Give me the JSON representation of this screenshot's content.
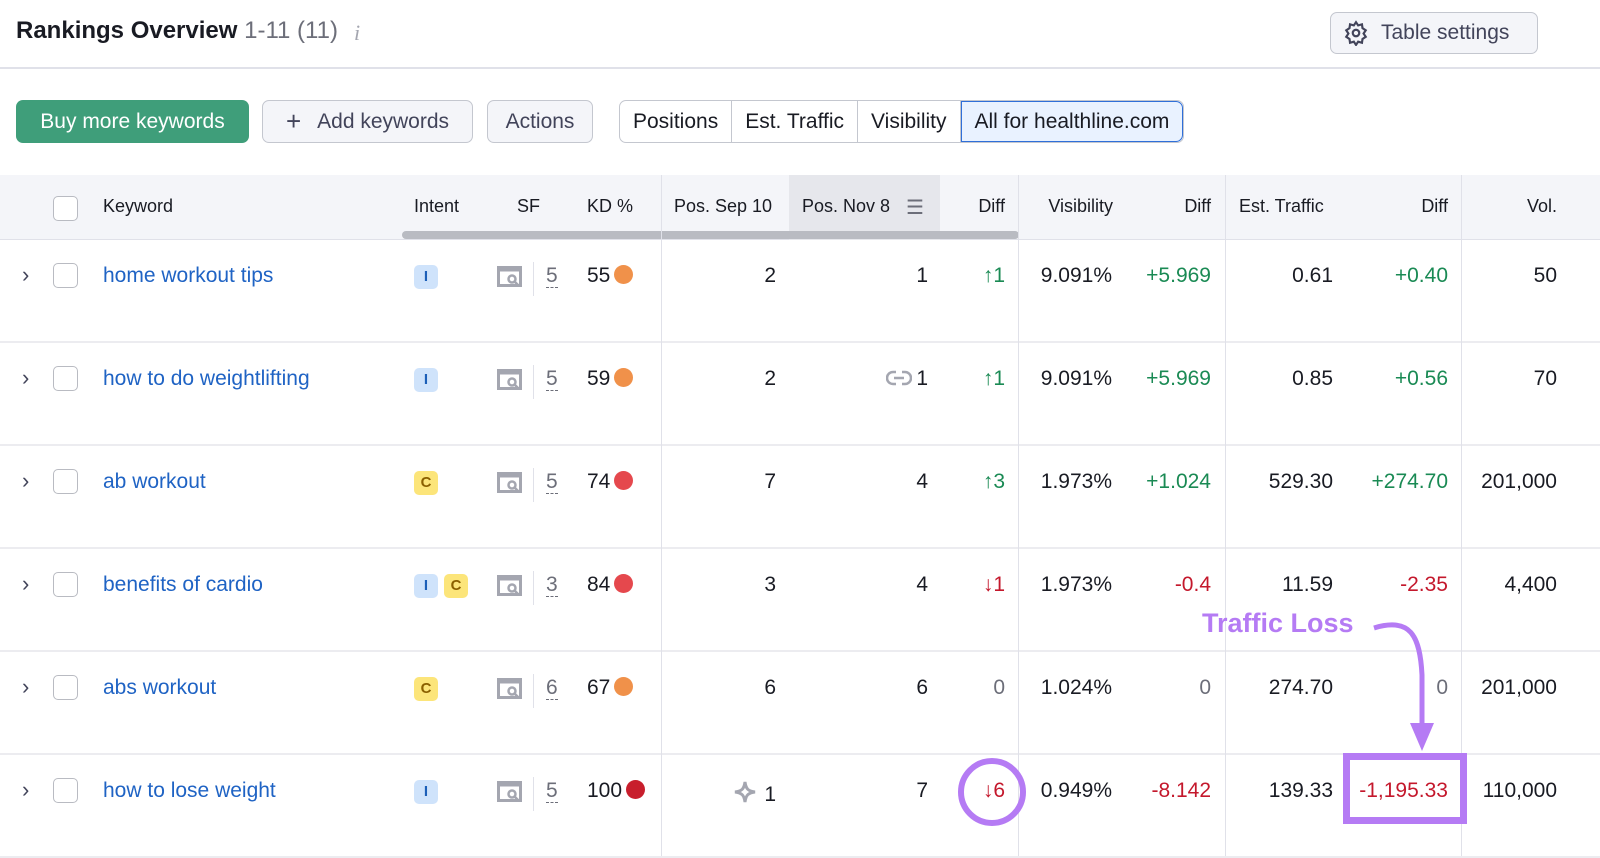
{
  "header": {
    "title": "Rankings Overview",
    "count": "1-11 (11)",
    "info_icon": "i",
    "table_settings": "Table settings"
  },
  "toolbar": {
    "buy": "Buy more keywords",
    "add": "Add keywords",
    "actions": "Actions",
    "segments": [
      "Positions",
      "Est. Traffic",
      "Visibility",
      "All for healthline.com"
    ],
    "selected_segment": "All for healthline.com"
  },
  "columns": {
    "keyword": "Keyword",
    "intent": "Intent",
    "sf": "SF",
    "kd": "KD %",
    "pos1": "Pos. Sep 10",
    "pos2": "Pos. Nov 8",
    "diff": "Diff",
    "vis": "Visibility",
    "vdiff": "Diff",
    "traffic": "Est. Traffic",
    "tdiff": "Diff",
    "vol": "Vol."
  },
  "colors": {
    "positive": "#1a8a54",
    "negative": "#c4182c",
    "kd_orange": "#f0914a",
    "kd_red": "#e5484d",
    "kd_darkred": "#c81e2c",
    "annotation": "#b57bf4"
  },
  "rows": [
    {
      "keyword": "home workout tips",
      "intent": [
        "I"
      ],
      "sf": "5",
      "kd": "55",
      "kd_color": "orange",
      "pos1": "2",
      "pos1_icon": "",
      "pos2": "1",
      "pos2_icon": "",
      "diff": "↑1",
      "diff_sign": "pos",
      "vis": "9.091%",
      "vdiff": "+5.969",
      "vdiff_sign": "pos",
      "traffic": "0.61",
      "tdiff": "+0.40",
      "tdiff_sign": "pos",
      "vol": "50"
    },
    {
      "keyword": "how to do weightlifting",
      "intent": [
        "I"
      ],
      "sf": "5",
      "kd": "59",
      "kd_color": "orange",
      "pos1": "2",
      "pos1_icon": "",
      "pos2": "1",
      "pos2_icon": "link-icon",
      "diff": "↑1",
      "diff_sign": "pos",
      "vis": "9.091%",
      "vdiff": "+5.969",
      "vdiff_sign": "pos",
      "traffic": "0.85",
      "tdiff": "+0.56",
      "tdiff_sign": "pos",
      "vol": "70"
    },
    {
      "keyword": "ab workout",
      "intent": [
        "C"
      ],
      "sf": "5",
      "kd": "74",
      "kd_color": "red",
      "pos1": "7",
      "pos1_icon": "",
      "pos2": "4",
      "pos2_icon": "",
      "diff": "↑3",
      "diff_sign": "pos",
      "vis": "1.973%",
      "vdiff": "+1.024",
      "vdiff_sign": "pos",
      "traffic": "529.30",
      "tdiff": "+274.70",
      "tdiff_sign": "pos",
      "vol": "201,000"
    },
    {
      "keyword": "benefits of cardio",
      "intent": [
        "I",
        "C"
      ],
      "sf": "3",
      "kd": "84",
      "kd_color": "red",
      "pos1": "3",
      "pos1_icon": "",
      "pos2": "4",
      "pos2_icon": "",
      "diff": "↓1",
      "diff_sign": "neg",
      "vis": "1.973%",
      "vdiff": "-0.4",
      "vdiff_sign": "neg",
      "traffic": "11.59",
      "tdiff": "-2.35",
      "tdiff_sign": "neg",
      "vol": "4,400"
    },
    {
      "keyword": "abs workout",
      "intent": [
        "C"
      ],
      "sf": "6",
      "kd": "67",
      "kd_color": "orange",
      "pos1": "6",
      "pos1_icon": "",
      "pos2": "6",
      "pos2_icon": "",
      "diff": "0",
      "diff_sign": "zero",
      "vis": "1.024%",
      "vdiff": "0",
      "vdiff_sign": "zero",
      "traffic": "274.70",
      "tdiff": "0",
      "tdiff_sign": "zero",
      "vol": "201,000"
    },
    {
      "keyword": "how to lose weight",
      "intent": [
        "I"
      ],
      "sf": "5",
      "kd": "100",
      "kd_color": "darkred",
      "pos1": "1",
      "pos1_icon": "sparkle-icon",
      "pos2": "7",
      "pos2_icon": "",
      "diff": "↓6",
      "diff_sign": "neg",
      "vis": "0.949%",
      "vdiff": "-8.142",
      "vdiff_sign": "neg",
      "traffic": "139.33",
      "tdiff": "-1,195.33",
      "tdiff_sign": "neg",
      "vol": "110,000"
    }
  ],
  "annotation": {
    "label": "Traffic Loss"
  }
}
